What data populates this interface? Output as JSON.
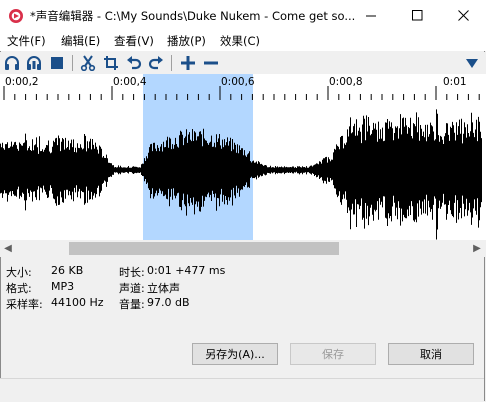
{
  "window": {
    "title": "*声音编辑器 - C:\\My Sounds\\Duke Nukem - Come get so...",
    "minimize_glyph": "—",
    "maximize_glyph": "☐",
    "close_glyph": "✕"
  },
  "menu": [
    {
      "label": "文件(F)"
    },
    {
      "label": "编辑(E)"
    },
    {
      "label": "查看(V)"
    },
    {
      "label": "播放(P)"
    },
    {
      "label": "效果(C)"
    }
  ],
  "toolbar": {
    "icons": [
      "headphones-icon",
      "headphones-selection-icon",
      "stop-icon",
      "cut-icon",
      "crop-icon",
      "undo-icon",
      "redo-icon",
      "zoom-in-icon",
      "zoom-out-icon",
      "dropdown-icon"
    ]
  },
  "ruler": {
    "labels": [
      "0:00,2",
      "0:00,4",
      "0:00,6",
      "0:00,8",
      "0:01"
    ]
  },
  "colors": {
    "selection": "#b3d7ff",
    "waveform": "#000000",
    "accent": "#e81123"
  },
  "info": {
    "size_label": "大小:",
    "size_value": "26 KB",
    "format_label": "格式:",
    "format_value": "MP3",
    "rate_label": "采样率:",
    "rate_value": "44100 Hz",
    "duration_label": "时长:",
    "duration_value": "0:01 +477 ms",
    "channels_label": "声道:",
    "channels_value": "立体声",
    "volume_label": "音量:",
    "volume_value": "97.0 dB"
  },
  "buttons": {
    "save_as": "另存为(A)...",
    "save": "保存",
    "cancel": "取消"
  }
}
